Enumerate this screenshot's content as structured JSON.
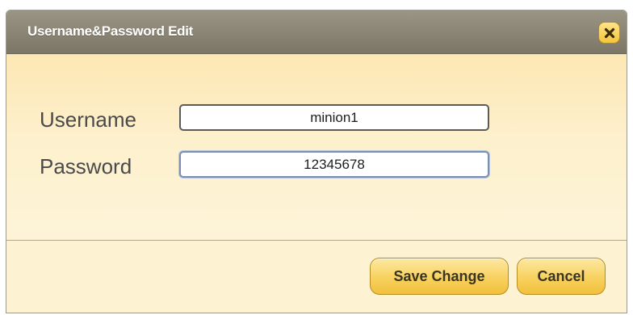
{
  "dialog": {
    "title": "Username&Password Edit",
    "close_icon": "close-icon"
  },
  "form": {
    "username_label": "Username",
    "username_value": "minion1",
    "password_label": "Password",
    "password_value": "12345678"
  },
  "buttons": {
    "save_label": "Save Change",
    "cancel_label": "Cancel"
  },
  "colors": {
    "titlebar": "#8a8474",
    "dialog_background": "#fdf3d3",
    "button_accent": "#f4c63c"
  }
}
